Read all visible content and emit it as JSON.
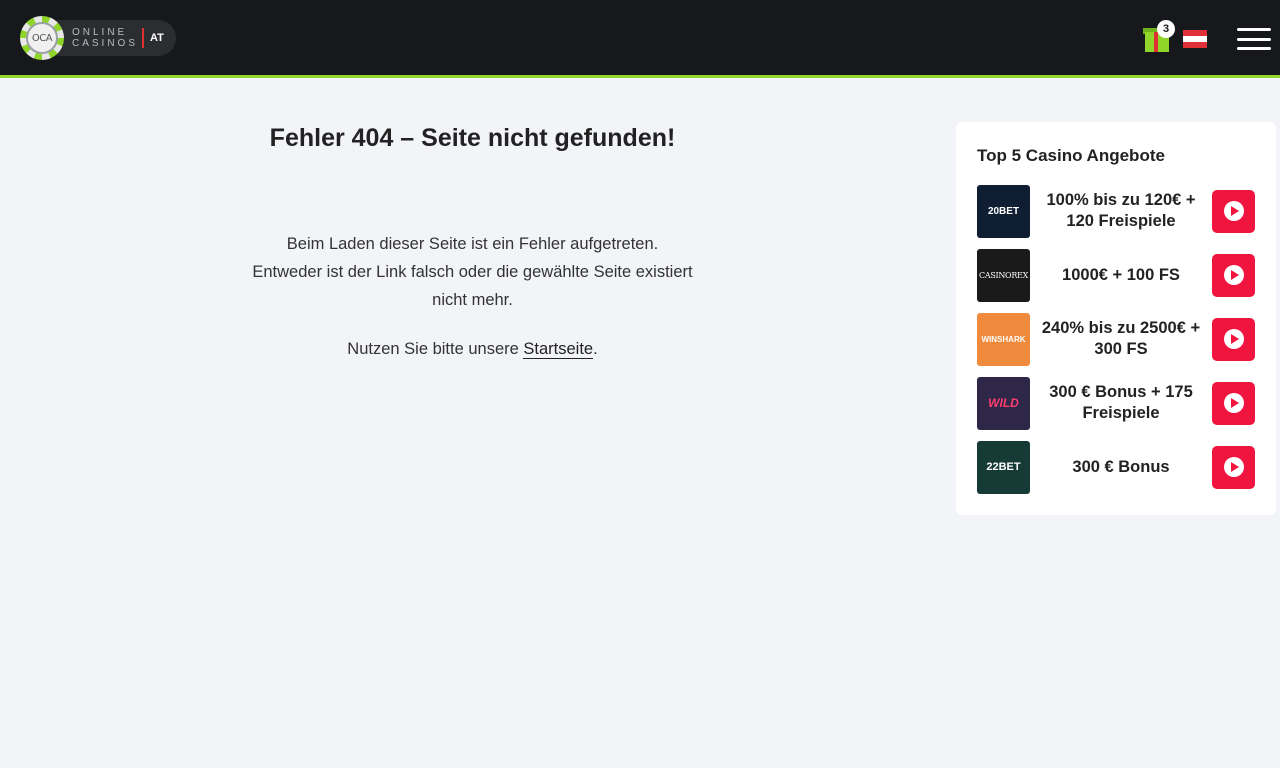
{
  "header": {
    "logo": {
      "chip_text": "OCA",
      "line1": "ONLINE",
      "line2": "CASINOS",
      "region": "AT"
    },
    "gift_count": "3",
    "flag": {
      "colors": [
        "#e0303a",
        "#ffffff",
        "#e0303a"
      ]
    },
    "menu_icon": "hamburger-icon"
  },
  "main": {
    "title": "Fehler 404 – Seite nicht gefunden!",
    "message_line1": "Beim Laden dieser Seite ist ein Fehler aufgetreten.",
    "message_line2": "Entweder ist der Link falsch oder die gewählte Seite existiert",
    "message_line3": "nicht mehr.",
    "hint_prefix": "Nutzen Sie bitte unsere ",
    "hint_link": "Startseite",
    "hint_suffix": "."
  },
  "sidebar": {
    "title": "Top 5 Casino Angebote",
    "offers": [
      {
        "logo_text": "20BET",
        "logo_bg": "#0f1e33",
        "offer": "100% bis zu 120€ + 120 Freispiele"
      },
      {
        "logo_text": "CASINOREX",
        "logo_bg": "#1a1a1a",
        "offer": "1000€ + 100 FS"
      },
      {
        "logo_text": "WINSHARK",
        "logo_bg": "#f08a3c",
        "offer": "240% bis zu 2500€ + 300 FS"
      },
      {
        "logo_text": "WILD",
        "logo_bg": "#2e2748",
        "offer": "300 € Bonus + 175 Freispiele"
      },
      {
        "logo_text": "22BET",
        "logo_bg": "#163a35",
        "offer": "300 € Bonus"
      }
    ]
  },
  "colors": {
    "accent": "#8fd52a",
    "cta": "#f0153e",
    "header_bg": "#16181b"
  }
}
